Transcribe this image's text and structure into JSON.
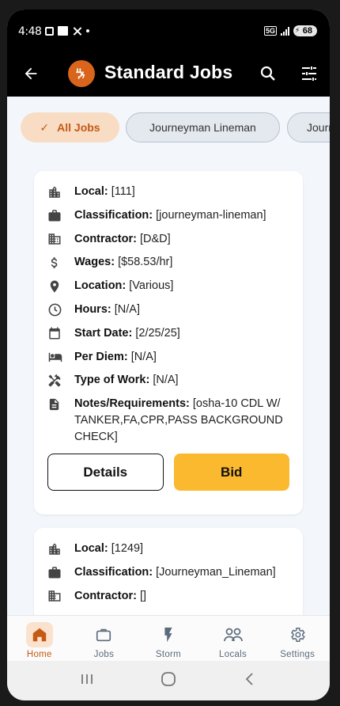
{
  "status_bar": {
    "time": "4:48",
    "network": "5G",
    "battery": "68"
  },
  "app_bar": {
    "title": "Standard Jobs"
  },
  "filters": [
    {
      "label": "All Jobs",
      "selected": true
    },
    {
      "label": "Journeyman Lineman",
      "selected": false
    },
    {
      "label": "Journeyman",
      "selected": false
    }
  ],
  "jobs": [
    {
      "fields": [
        {
          "label": "Local:",
          "value": "[111]"
        },
        {
          "label": "Classification:",
          "value": "[journeyman-lineman]"
        },
        {
          "label": "Contractor:",
          "value": "[D&D]"
        },
        {
          "label": "Wages:",
          "value": "[$58.53/hr]"
        },
        {
          "label": "Location:",
          "value": "[Various]"
        },
        {
          "label": "Hours:",
          "value": "[N/A]"
        },
        {
          "label": "Start Date:",
          "value": "[2/25/25]"
        },
        {
          "label": "Per Diem:",
          "value": "[N/A]"
        },
        {
          "label": "Type of Work:",
          "value": "[N/A]"
        },
        {
          "label": "Notes/Requirements:",
          "value": "[osha-10 CDL W/ TANKER,FA,CPR,PASS BACKGROUND CHECK]"
        }
      ],
      "details_label": "Details",
      "bid_label": "Bid"
    },
    {
      "fields": [
        {
          "label": "Local:",
          "value": "[1249]"
        },
        {
          "label": "Classification:",
          "value": "[Journeyman_Lineman]"
        },
        {
          "label": "Contractor:",
          "value": "[]"
        }
      ]
    }
  ],
  "bottom_nav": [
    {
      "label": "Home",
      "icon": "home-icon",
      "active": true
    },
    {
      "label": "Jobs",
      "icon": "briefcase-icon",
      "active": false
    },
    {
      "label": "Storm",
      "icon": "lightning-icon",
      "active": false
    },
    {
      "label": "Locals",
      "icon": "group-icon",
      "active": false
    },
    {
      "label": "Settings",
      "icon": "gear-icon",
      "active": false
    }
  ],
  "colors": {
    "accent": "#d9641b",
    "bid_button": "#fbb92f",
    "app_bar": "#000000",
    "background": "#f3f7fc"
  }
}
